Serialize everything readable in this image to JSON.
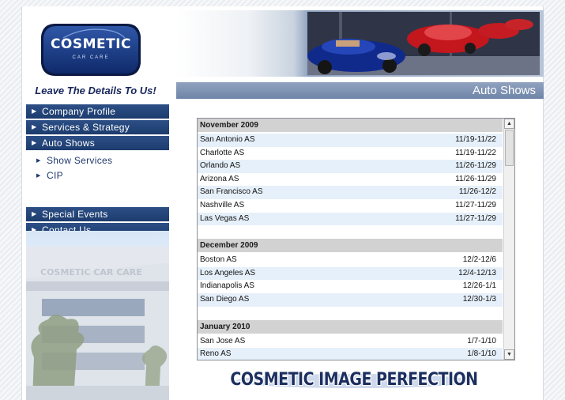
{
  "logo": {
    "name": "COSMETIC",
    "subtitle": "CAR CARE"
  },
  "tagline": "Leave The Details To Us!",
  "menu": {
    "items": [
      {
        "label": "Company Profile"
      },
      {
        "label": "Services & Strategy"
      },
      {
        "label": "Auto Shows"
      }
    ],
    "sub_items": [
      {
        "label": "Show Services"
      },
      {
        "label": "CIP"
      }
    ],
    "lower_items": [
      {
        "label": "Special Events"
      },
      {
        "label": "Contact Us"
      }
    ]
  },
  "building_sign": "COSMETIC CAR CARE",
  "header": {
    "title": "Auto Shows"
  },
  "schedule": {
    "groups": [
      {
        "month": "November 2009",
        "rows": [
          {
            "show": "San Antonio AS",
            "dates": "11/19-11/22"
          },
          {
            "show": "Charlotte AS",
            "dates": "11/19-11/22"
          },
          {
            "show": "Orlando AS",
            "dates": "11/26-11/29"
          },
          {
            "show": "Arizona AS",
            "dates": "11/26-11/29"
          },
          {
            "show": "San Francisco AS",
            "dates": "11/26-12/2"
          },
          {
            "show": "Nashville AS",
            "dates": "11/27-11/29"
          },
          {
            "show": "Las Vegas AS",
            "dates": "11/27-11/29"
          }
        ]
      },
      {
        "month": "December 2009",
        "rows": [
          {
            "show": "Boston AS",
            "dates": "12/2-12/6"
          },
          {
            "show": "Los Angeles AS",
            "dates": "12/4-12/13"
          },
          {
            "show": "Indianapolis AS",
            "dates": "12/26-1/1"
          },
          {
            "show": "San Diego AS",
            "dates": "12/30-1/3"
          }
        ]
      },
      {
        "month": "January 2010",
        "rows": [
          {
            "show": "San Jose AS",
            "dates": "1/7-1/10"
          },
          {
            "show": "Reno AS",
            "dates": "1/8-1/10"
          }
        ]
      }
    ]
  },
  "footer": {
    "banner": "COSMETIC IMAGE PERFECTION"
  },
  "colors": {
    "nav_blue": "#1d3c6e",
    "title_bar": "#7a8fb1",
    "row_alt": "#e6f0fa"
  }
}
